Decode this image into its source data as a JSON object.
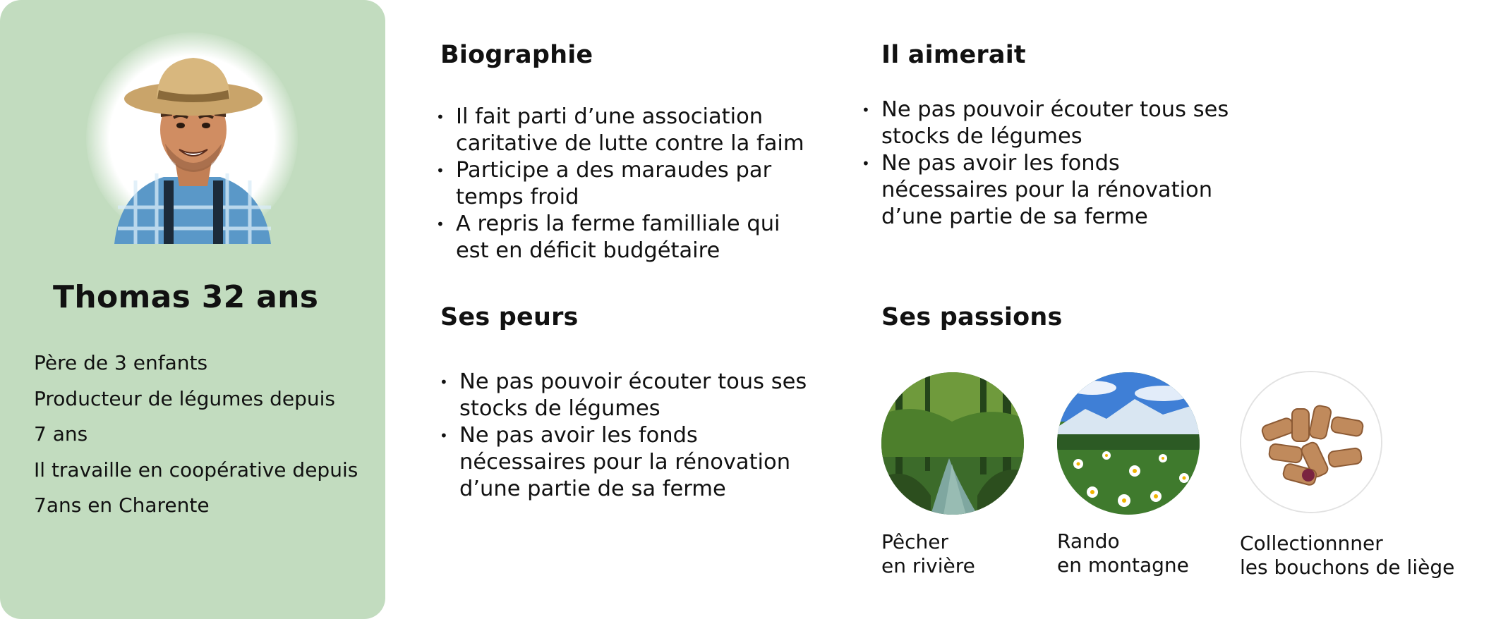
{
  "profile": {
    "name": "Thomas 32 ans",
    "facts": [
      "Père de 3 enfants",
      "Producteur de légumes depuis",
      "7 ans",
      "Il travaille en coopérative depuis",
      "7ans en Charente"
    ]
  },
  "biography": {
    "title": "Biographie",
    "items": [
      [
        "Il fait parti d’une association",
        "caritative de lutte contre la faim"
      ],
      [
        "Participe a des maraudes par",
        "temps froid"
      ],
      [
        "A repris la ferme familliale qui",
        "est en déficit budgétaire"
      ]
    ]
  },
  "wishes": {
    "title": "Il aimerait",
    "items": [
      [
        "Ne pas pouvoir écouter tous ses",
        "stocks de légumes"
      ],
      [
        "Ne pas avoir les fonds",
        "nécessaires pour la rénovation",
        "d’une partie de sa ferme"
      ]
    ]
  },
  "fears": {
    "title": "Ses peurs",
    "items": [
      [
        "Ne pas pouvoir écouter tous ses",
        "stocks de légumes"
      ],
      [
        "Ne pas avoir les fonds",
        "nécessaires pour la rénovation",
        "d’une partie de sa ferme"
      ]
    ]
  },
  "passions": {
    "title": "Ses passions",
    "items": [
      {
        "image": "forest-river-photo",
        "lines": [
          "Pêcher",
          "en rivière"
        ]
      },
      {
        "image": "mountain-meadow-photo",
        "lines": [
          "Rando",
          "en montagne"
        ]
      },
      {
        "image": "wine-corks-photo",
        "lines": [
          "Collectionnner",
          "les bouchons de liège"
        ]
      }
    ]
  },
  "colors": {
    "card_background": "#c2dcbf",
    "text": "#111111"
  }
}
